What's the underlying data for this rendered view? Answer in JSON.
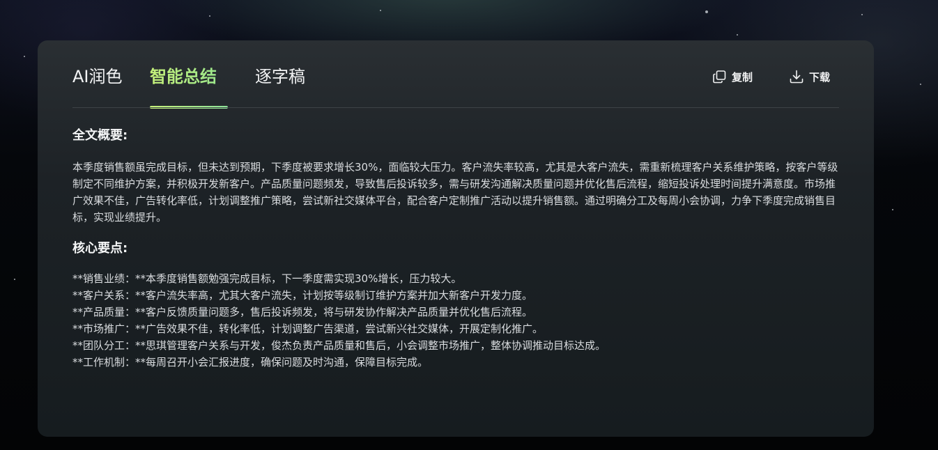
{
  "tabs": [
    {
      "label": "AI润色",
      "active": false
    },
    {
      "label": "智能总结",
      "active": true
    },
    {
      "label": "逐字稿",
      "active": false
    }
  ],
  "actions": {
    "copy": {
      "label": "复制",
      "icon": "copy-icon"
    },
    "download": {
      "label": "下载",
      "icon": "download-icon"
    }
  },
  "summary": {
    "title": "全文概要:",
    "text": "本季度销售额虽完成目标，但未达到预期，下季度被要求增长30%，面临较大压力。客户流失率较高，尤其是大客户流失，需重新梳理客户关系维护策略，按客户等级制定不同维护方案，并积极开发新客户。产品质量问题频发，导致售后投诉较多，需与研发沟通解决质量问题并优化售后流程，缩短投诉处理时间提升满意度。市场推广效果不佳，广告转化率低，计划调整推广策略，尝试新社交媒体平台，配合客户定制推广活动以提升销售额。通过明确分工及每周小会协调，力争下季度完成销售目标，实现业绩提升。"
  },
  "key_points": {
    "title": "核心要点:",
    "items": [
      "**销售业绩：**本季度销售额勉强完成目标，下一季度需实现30%增长，压力较大。",
      "**客户关系：**客户流失率高，尤其大客户流失，计划按等级制订维护方案并加大新客户开发力度。",
      "**产品质量：**客户反馈质量问题多，售后投诉频发，将与研发协作解决产品质量并优化售后流程。",
      "**市场推广：**广告效果不佳，转化率低，计划调整广告渠道，尝试新兴社交媒体，开展定制化推广。",
      "**团队分工：**思琪管理客户关系与开发，俊杰负责产品质量和售后，小会调整市场推广，整体协调推动目标达成。",
      "**工作机制：**每周召开小会汇报进度，确保问题及时沟通，保障目标完成。"
    ]
  },
  "colors": {
    "accent": "#b6f27a",
    "panel": "#1d2226",
    "text": "#d9dcdf"
  }
}
